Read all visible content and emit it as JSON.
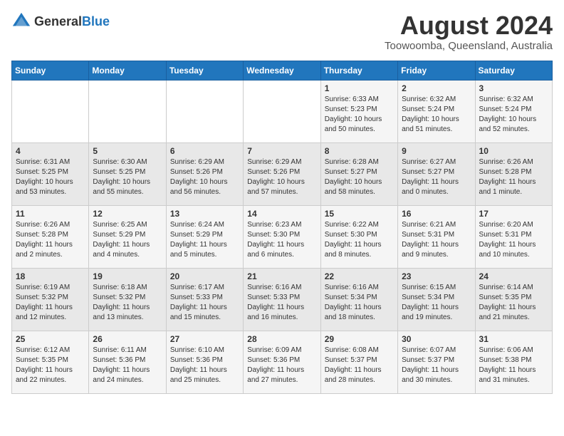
{
  "logo": {
    "general": "General",
    "blue": "Blue"
  },
  "title": {
    "month_year": "August 2024",
    "location": "Toowoomba, Queensland, Australia"
  },
  "weekdays": [
    "Sunday",
    "Monday",
    "Tuesday",
    "Wednesday",
    "Thursday",
    "Friday",
    "Saturday"
  ],
  "weeks": [
    [
      {
        "day": "",
        "info": ""
      },
      {
        "day": "",
        "info": ""
      },
      {
        "day": "",
        "info": ""
      },
      {
        "day": "",
        "info": ""
      },
      {
        "day": "1",
        "info": "Sunrise: 6:33 AM\nSunset: 5:23 PM\nDaylight: 10 hours\nand 50 minutes."
      },
      {
        "day": "2",
        "info": "Sunrise: 6:32 AM\nSunset: 5:24 PM\nDaylight: 10 hours\nand 51 minutes."
      },
      {
        "day": "3",
        "info": "Sunrise: 6:32 AM\nSunset: 5:24 PM\nDaylight: 10 hours\nand 52 minutes."
      }
    ],
    [
      {
        "day": "4",
        "info": "Sunrise: 6:31 AM\nSunset: 5:25 PM\nDaylight: 10 hours\nand 53 minutes."
      },
      {
        "day": "5",
        "info": "Sunrise: 6:30 AM\nSunset: 5:25 PM\nDaylight: 10 hours\nand 55 minutes."
      },
      {
        "day": "6",
        "info": "Sunrise: 6:29 AM\nSunset: 5:26 PM\nDaylight: 10 hours\nand 56 minutes."
      },
      {
        "day": "7",
        "info": "Sunrise: 6:29 AM\nSunset: 5:26 PM\nDaylight: 10 hours\nand 57 minutes."
      },
      {
        "day": "8",
        "info": "Sunrise: 6:28 AM\nSunset: 5:27 PM\nDaylight: 10 hours\nand 58 minutes."
      },
      {
        "day": "9",
        "info": "Sunrise: 6:27 AM\nSunset: 5:27 PM\nDaylight: 11 hours\nand 0 minutes."
      },
      {
        "day": "10",
        "info": "Sunrise: 6:26 AM\nSunset: 5:28 PM\nDaylight: 11 hours\nand 1 minute."
      }
    ],
    [
      {
        "day": "11",
        "info": "Sunrise: 6:26 AM\nSunset: 5:28 PM\nDaylight: 11 hours\nand 2 minutes."
      },
      {
        "day": "12",
        "info": "Sunrise: 6:25 AM\nSunset: 5:29 PM\nDaylight: 11 hours\nand 4 minutes."
      },
      {
        "day": "13",
        "info": "Sunrise: 6:24 AM\nSunset: 5:29 PM\nDaylight: 11 hours\nand 5 minutes."
      },
      {
        "day": "14",
        "info": "Sunrise: 6:23 AM\nSunset: 5:30 PM\nDaylight: 11 hours\nand 6 minutes."
      },
      {
        "day": "15",
        "info": "Sunrise: 6:22 AM\nSunset: 5:30 PM\nDaylight: 11 hours\nand 8 minutes."
      },
      {
        "day": "16",
        "info": "Sunrise: 6:21 AM\nSunset: 5:31 PM\nDaylight: 11 hours\nand 9 minutes."
      },
      {
        "day": "17",
        "info": "Sunrise: 6:20 AM\nSunset: 5:31 PM\nDaylight: 11 hours\nand 10 minutes."
      }
    ],
    [
      {
        "day": "18",
        "info": "Sunrise: 6:19 AM\nSunset: 5:32 PM\nDaylight: 11 hours\nand 12 minutes."
      },
      {
        "day": "19",
        "info": "Sunrise: 6:18 AM\nSunset: 5:32 PM\nDaylight: 11 hours\nand 13 minutes."
      },
      {
        "day": "20",
        "info": "Sunrise: 6:17 AM\nSunset: 5:33 PM\nDaylight: 11 hours\nand 15 minutes."
      },
      {
        "day": "21",
        "info": "Sunrise: 6:16 AM\nSunset: 5:33 PM\nDaylight: 11 hours\nand 16 minutes."
      },
      {
        "day": "22",
        "info": "Sunrise: 6:16 AM\nSunset: 5:34 PM\nDaylight: 11 hours\nand 18 minutes."
      },
      {
        "day": "23",
        "info": "Sunrise: 6:15 AM\nSunset: 5:34 PM\nDaylight: 11 hours\nand 19 minutes."
      },
      {
        "day": "24",
        "info": "Sunrise: 6:14 AM\nSunset: 5:35 PM\nDaylight: 11 hours\nand 21 minutes."
      }
    ],
    [
      {
        "day": "25",
        "info": "Sunrise: 6:12 AM\nSunset: 5:35 PM\nDaylight: 11 hours\nand 22 minutes."
      },
      {
        "day": "26",
        "info": "Sunrise: 6:11 AM\nSunset: 5:36 PM\nDaylight: 11 hours\nand 24 minutes."
      },
      {
        "day": "27",
        "info": "Sunrise: 6:10 AM\nSunset: 5:36 PM\nDaylight: 11 hours\nand 25 minutes."
      },
      {
        "day": "28",
        "info": "Sunrise: 6:09 AM\nSunset: 5:36 PM\nDaylight: 11 hours\nand 27 minutes."
      },
      {
        "day": "29",
        "info": "Sunrise: 6:08 AM\nSunset: 5:37 PM\nDaylight: 11 hours\nand 28 minutes."
      },
      {
        "day": "30",
        "info": "Sunrise: 6:07 AM\nSunset: 5:37 PM\nDaylight: 11 hours\nand 30 minutes."
      },
      {
        "day": "31",
        "info": "Sunrise: 6:06 AM\nSunset: 5:38 PM\nDaylight: 11 hours\nand 31 minutes."
      }
    ]
  ]
}
